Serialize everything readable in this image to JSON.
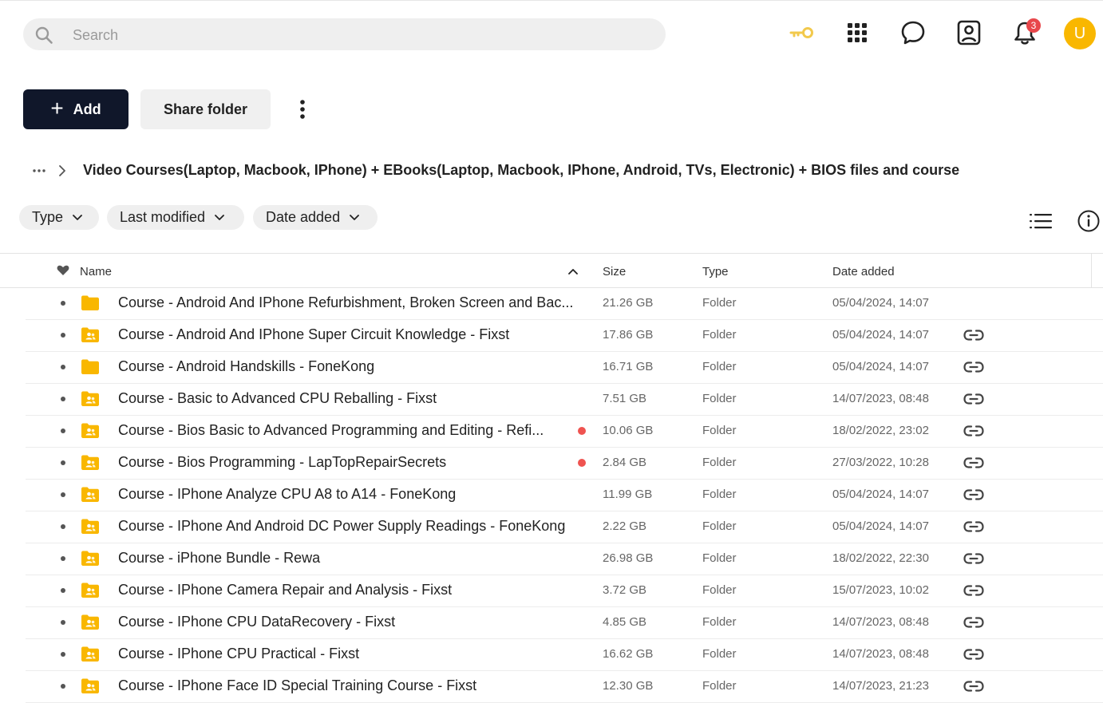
{
  "search": {
    "placeholder": "Search"
  },
  "notifications": {
    "count": "3"
  },
  "user": {
    "initial": "U"
  },
  "toolbar": {
    "add_label": "Add",
    "share_label": "Share folder"
  },
  "breadcrumb": {
    "current": "Video Courses(Laptop, Macbook, IPhone) + EBooks(Laptop, Macbook, IPhone, Android, TVs, Electronic) + BIOS files and course"
  },
  "filters": {
    "type": "Type",
    "last_modified": "Last modified",
    "date_added": "Date added"
  },
  "columns": {
    "name": "Name",
    "size": "Size",
    "type": "Type",
    "date_added": "Date added"
  },
  "colors": {
    "accent_dark": "#10172a",
    "folder_yellow": "#f9b700",
    "badge_red": "#e8474b",
    "status_red": "#ef5350",
    "key_yellow": "#f2c94c"
  },
  "rows": [
    {
      "name": "Course - Android And IPhone Refurbishment, Broken Screen and Bac...",
      "size": "21.26 GB",
      "type": "Folder",
      "date": "05/04/2024, 14:07",
      "shared": false,
      "flag": false,
      "link": false
    },
    {
      "name": "Course - Android And IPhone Super Circuit Knowledge - Fixst",
      "size": "17.86 GB",
      "type": "Folder",
      "date": "05/04/2024, 14:07",
      "shared": true,
      "flag": false,
      "link": true
    },
    {
      "name": "Course - Android Handskills - FoneKong",
      "size": "16.71 GB",
      "type": "Folder",
      "date": "05/04/2024, 14:07",
      "shared": false,
      "flag": false,
      "link": true
    },
    {
      "name": "Course - Basic to Advanced CPU Reballing - Fixst",
      "size": "7.51 GB",
      "type": "Folder",
      "date": "14/07/2023, 08:48",
      "shared": true,
      "flag": false,
      "link": true
    },
    {
      "name": "Course - Bios Basic to Advanced Programming and Editing - Refi...",
      "size": "10.06 GB",
      "type": "Folder",
      "date": "18/02/2022, 23:02",
      "shared": true,
      "flag": true,
      "link": true
    },
    {
      "name": "Course - Bios Programming - LapTopRepairSecrets",
      "size": "2.84 GB",
      "type": "Folder",
      "date": "27/03/2022, 10:28",
      "shared": true,
      "flag": true,
      "link": true
    },
    {
      "name": "Course - IPhone Analyze CPU A8 to A14 - FoneKong",
      "size": "11.99 GB",
      "type": "Folder",
      "date": "05/04/2024, 14:07",
      "shared": true,
      "flag": false,
      "link": true
    },
    {
      "name": "Course - IPhone And Android DC Power Supply Readings - FoneKong",
      "size": "2.22 GB",
      "type": "Folder",
      "date": "05/04/2024, 14:07",
      "shared": true,
      "flag": false,
      "link": true
    },
    {
      "name": "Course - iPhone Bundle - Rewa",
      "size": "26.98 GB",
      "type": "Folder",
      "date": "18/02/2022, 22:30",
      "shared": true,
      "flag": false,
      "link": true
    },
    {
      "name": "Course - IPhone Camera Repair and Analysis - Fixst",
      "size": "3.72 GB",
      "type": "Folder",
      "date": "15/07/2023, 10:02",
      "shared": true,
      "flag": false,
      "link": true
    },
    {
      "name": "Course - IPhone CPU DataRecovery - Fixst",
      "size": "4.85 GB",
      "type": "Folder",
      "date": "14/07/2023, 08:48",
      "shared": true,
      "flag": false,
      "link": true
    },
    {
      "name": "Course - IPhone CPU Practical - Fixst",
      "size": "16.62 GB",
      "type": "Folder",
      "date": "14/07/2023, 08:48",
      "shared": true,
      "flag": false,
      "link": true
    },
    {
      "name": "Course - IPhone Face ID Special Training Course - Fixst",
      "size": "12.30 GB",
      "type": "Folder",
      "date": "14/07/2023, 21:23",
      "shared": true,
      "flag": false,
      "link": true
    }
  ]
}
